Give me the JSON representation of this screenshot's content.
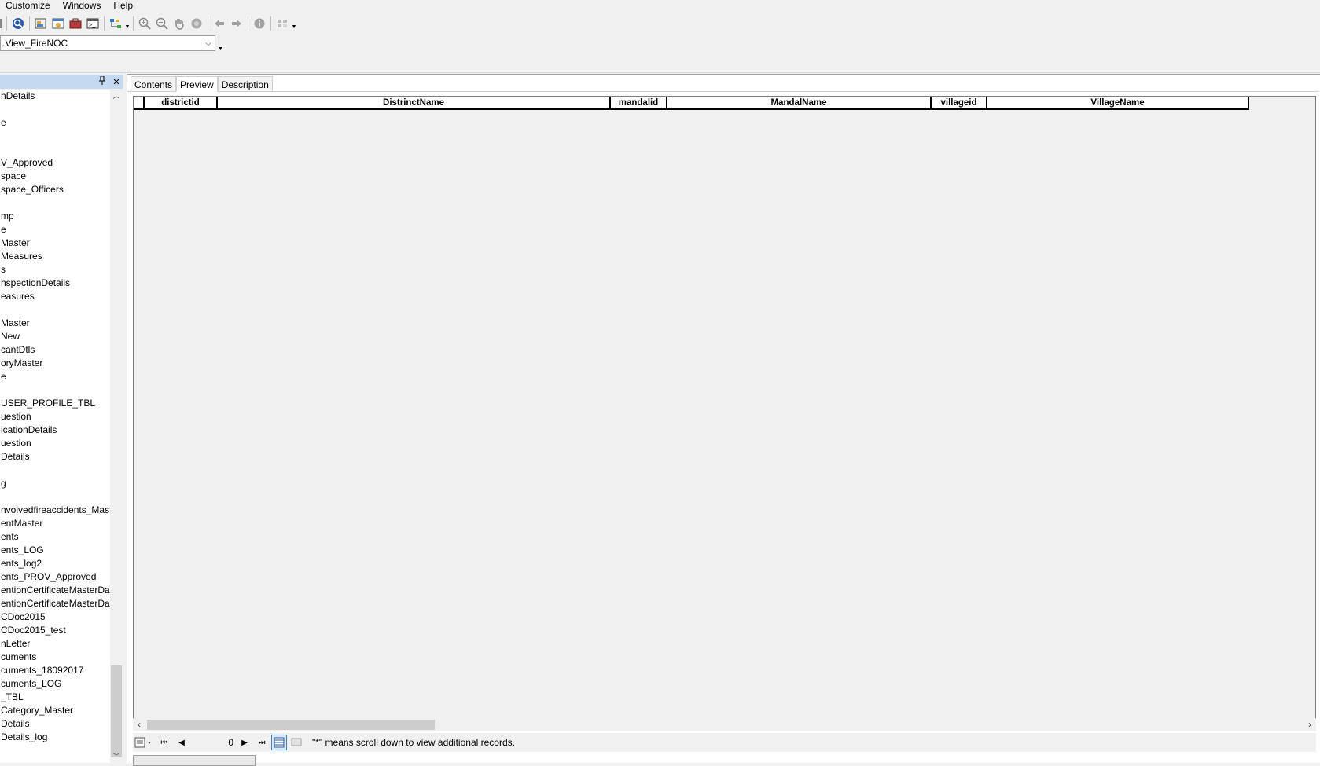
{
  "menu": [
    "Customize",
    "Windows",
    "Help"
  ],
  "toolbar": {
    "buttons": [
      "toolbox-partial-icon",
      "search-globe-icon",
      "catalog-icon",
      "catalog-window-icon",
      "arc-toolbox-icon",
      "python-window-icon",
      "model-builder-icon",
      "zoom-in-icon",
      "zoom-out-icon",
      "pan-icon",
      "full-extent-icon",
      "back-icon",
      "forward-icon",
      "identify-icon",
      "launch-icon"
    ]
  },
  "location": {
    "value": ".View_FireNOC"
  },
  "panel": {
    "pin_icon": "pin-icon",
    "close_icon": "close-icon",
    "tree_items": [
      "nDetails",
      "",
      "e",
      "",
      "",
      "V_Approved",
      "space",
      "space_Officers",
      "",
      "mp",
      "e",
      "Master",
      "Measures",
      "s",
      "nspectionDetails",
      "easures",
      "",
      "Master",
      "New",
      "cantDtls",
      "oryMaster",
      "e",
      "",
      "USER_PROFILE_TBL",
      "uestion",
      "icationDetails",
      "uestion",
      "Details",
      "",
      "g",
      "",
      "nvolvedfireaccidents_Maste",
      "entMaster",
      "ents",
      "ents_LOG",
      "ents_log2",
      "ents_PROV_Approved",
      "entionCertificateMasterDa",
      "entionCertificateMasterDa",
      "CDoc2015",
      "CDoc2015_test",
      "nLetter",
      "cuments",
      "cuments_18092017",
      "cuments_LOG",
      "_TBL",
      "Category_Master",
      "Details",
      "Details_log"
    ]
  },
  "tabs": [
    "Contents",
    "Preview",
    "Description"
  ],
  "active_tab": "Preview",
  "grid": {
    "columns": [
      "districtid",
      "DistrinctName",
      "mandalid",
      "MandalName",
      "villageid",
      "VillageName"
    ]
  },
  "navigation": {
    "record_count": "0",
    "note": "\"*\" means scroll down to view additional records."
  }
}
